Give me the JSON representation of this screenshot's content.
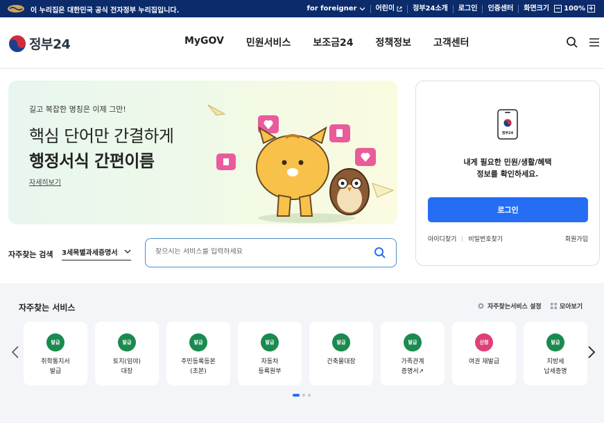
{
  "topbar": {
    "notice": "이 누리집은 대한민국 공식 전자정부 누리집입니다.",
    "links": [
      "for foreigner",
      "어린이",
      "정부24소개",
      "로그인",
      "인증센터",
      "화면크기"
    ],
    "zoom_minus": "−",
    "zoom_level": "100%",
    "zoom_plus": "+"
  },
  "header": {
    "logo_text": "정부24",
    "nav": [
      "MyGOV",
      "민원서비스",
      "보조금24",
      "정책정보",
      "고객센터"
    ]
  },
  "hero": {
    "kicker": "길고 복잡한 명칭은 이제 그만!",
    "title_line1": "핵심 단어만 간결하게",
    "title_line2": "행정서식 간편이름",
    "more_link": "자세히보기"
  },
  "login": {
    "message_line1": "내게 필요한 민원/생활/혜택",
    "message_line2": "정보를 확인하세요.",
    "phone_label": "정부24",
    "button": "로그인",
    "find_id": "아이디찾기",
    "find_pw": "비밀번호찾기",
    "join": "회원가입"
  },
  "search": {
    "label": "자주찾는 검색",
    "selected": "3세목별과세증명서",
    "placeholder": "찾으시는 서비스를 입력하세요"
  },
  "services": {
    "title": "자주찾는 서비스",
    "settings": "자주찾는서비스 설정",
    "view_all": "모아보기",
    "items": [
      {
        "badge": "발급",
        "label": "취학통지서\n발급",
        "color": "#1a8a4e"
      },
      {
        "badge": "발급",
        "label": "토지(임야)\n대장",
        "color": "#1a8a4e"
      },
      {
        "badge": "발급",
        "label": "주민등록등본\n(초본)",
        "color": "#1a8a4e"
      },
      {
        "badge": "발급",
        "label": "자동차\n등록원부",
        "color": "#1a8a4e"
      },
      {
        "badge": "발급",
        "label": "건축물대장",
        "color": "#1a8a4e"
      },
      {
        "badge": "발급",
        "label": "가족관계\n증명서↗",
        "color": "#1a8a4e"
      },
      {
        "badge": "신청",
        "label": "여권 재발급",
        "color": "#e0407a"
      },
      {
        "badge": "발급",
        "label": "지방세\n납세증명",
        "color": "#1a8a4e"
      }
    ],
    "page_count": 3,
    "active_page": 1
  },
  "colors": {
    "topbar": "#0b2b6b",
    "primary": "#256ef4",
    "issue_badge": "#1a8a4e",
    "apply_badge": "#e0407a"
  }
}
